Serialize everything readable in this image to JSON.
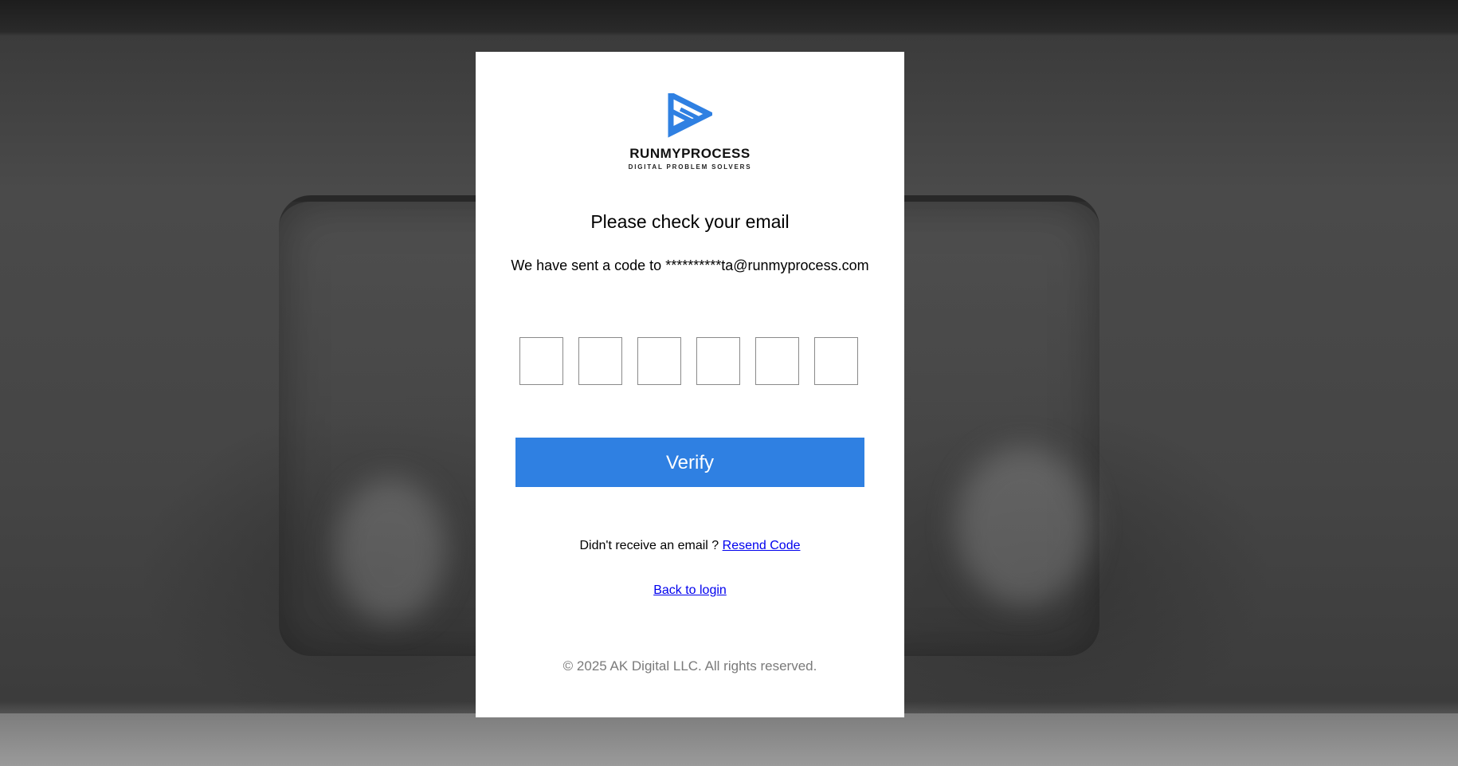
{
  "brand": {
    "name": "RUNMYPROCESS",
    "tagline": "DIGITAL PROBLEM SOLVERS",
    "logo_icon": "play-arrow-logo-icon",
    "accent_color": "#2f80e2"
  },
  "heading": "Please check your email",
  "message": "We have sent a code to **********ta@runmyprocess.com",
  "otp": {
    "digits": [
      "",
      "",
      "",
      "",
      "",
      ""
    ]
  },
  "verify_label": "Verify",
  "resend": {
    "prompt": "Didn't receive an email ? ",
    "link_label": "Resend Code"
  },
  "back_label": "Back to login",
  "footer": "© 2025 AK Digital LLC. All rights reserved."
}
